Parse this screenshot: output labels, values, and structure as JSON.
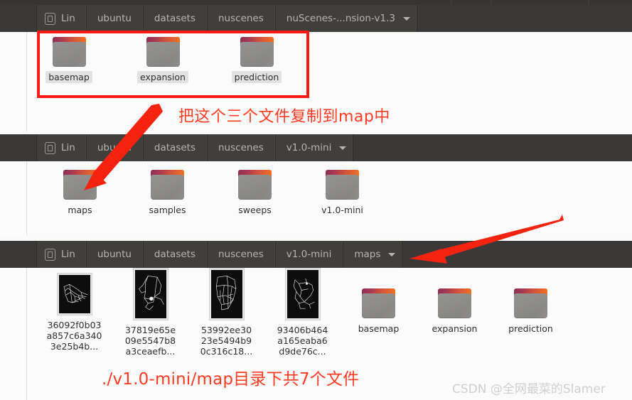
{
  "windows": [
    {
      "id": "window-nuscenes-expansion",
      "breadcrumbs": [
        {
          "label": "Lin",
          "icon": "device-icon",
          "has_caret": false
        },
        {
          "label": "ubuntu",
          "has_caret": false
        },
        {
          "label": "datasets",
          "has_caret": false
        },
        {
          "label": "nuscenes",
          "has_caret": false
        },
        {
          "label": "nuScenes-...nsion-v1.3",
          "has_caret": true
        }
      ],
      "files": [
        {
          "name": "basemap",
          "type": "folder",
          "selected": true
        },
        {
          "name": "expansion",
          "type": "folder",
          "selected": true
        },
        {
          "name": "prediction",
          "type": "folder",
          "selected": true
        }
      ]
    },
    {
      "id": "window-v10-mini",
      "breadcrumbs": [
        {
          "label": "Lin",
          "icon": "device-icon",
          "has_caret": false
        },
        {
          "label": "ubuntu",
          "has_caret": false
        },
        {
          "label": "datasets",
          "has_caret": false
        },
        {
          "label": "nuscenes",
          "has_caret": false
        },
        {
          "label": "v1.0-mini",
          "has_caret": true
        }
      ],
      "files": [
        {
          "name": "maps",
          "type": "folder",
          "selected": false
        },
        {
          "name": "samples",
          "type": "folder",
          "selected": false
        },
        {
          "name": "sweeps",
          "type": "folder",
          "selected": false
        },
        {
          "name": "v1.0-mini",
          "type": "folder",
          "selected": false
        }
      ]
    },
    {
      "id": "window-maps",
      "breadcrumbs": [
        {
          "label": "Lin",
          "icon": "device-icon",
          "has_caret": false
        },
        {
          "label": "ubuntu",
          "has_caret": false
        },
        {
          "label": "datasets",
          "has_caret": false
        },
        {
          "label": "nuscenes",
          "has_caret": false
        },
        {
          "label": "v1.0-mini",
          "has_caret": false
        },
        {
          "label": "maps",
          "has_caret": true
        }
      ],
      "files": [
        {
          "name": "36092f0b03\na857c6a340\n3e25b4b...",
          "type": "image",
          "selected": false
        },
        {
          "name": "37819e65e\n09e5547b8\na3ceaefb...",
          "type": "image",
          "selected": false
        },
        {
          "name": "53992ee30\n23e5494b9\n0c316c18...",
          "type": "image",
          "selected": false
        },
        {
          "name": "93406b464\na165eaba6\nd9de76c...",
          "type": "image",
          "selected": false
        },
        {
          "name": "basemap",
          "type": "folder",
          "selected": false
        },
        {
          "name": "expansion",
          "type": "folder",
          "selected": false
        },
        {
          "name": "prediction",
          "type": "folder",
          "selected": false
        }
      ]
    }
  ],
  "annotations": {
    "highlight_box_label": "red-highlight-rectangle",
    "note_top": "把这个三个文件复制到map中",
    "note_bottom": "./v1.0-mini/map目录下共7个文件",
    "arrow_top_label": "red-arrow-to-maps-folder",
    "arrow_bottom_label": "red-arrow-to-maps-breadcrumb"
  },
  "watermark": "CSDN @全网最菜的Slamer",
  "colors": {
    "annotation_red": "#fc3b22",
    "box_red": "#fc1a17",
    "titlebar": "#3a3937",
    "crumb_bg": "#403f3c",
    "crumb_text": "#b7b5b0",
    "pane_bg": "#fbfbfb",
    "folder_tab": "#a93a52",
    "folder_edge": "#f4701f",
    "folder_body": "#8d8c8a"
  }
}
